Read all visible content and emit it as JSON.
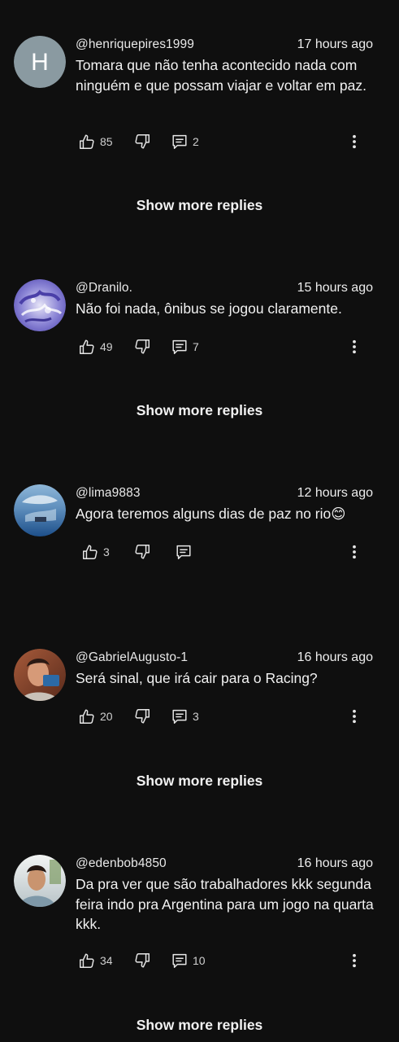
{
  "comments": [
    {
      "author": "@henriquepires1999",
      "time": "17 hours ago",
      "text": "Tomara que não tenha acontecido nada com ninguém e que possam viajar e voltar em paz.",
      "avatar_letter": "H",
      "likes": "85",
      "replies": "2",
      "show_more": "Show more replies"
    },
    {
      "author": "@Dranilo.",
      "time": "15 hours ago",
      "text": "Não foi nada, ônibus se jogou claramente.",
      "likes": "49",
      "replies": "7",
      "show_more": "Show more replies"
    },
    {
      "author": "@lima9883",
      "time": "12 hours ago",
      "text": "Agora teremos alguns dias de paz no rio😊",
      "likes": "3",
      "replies": ""
    },
    {
      "author": "@GabrielAugusto-1",
      "time": "16 hours ago",
      "text": "Será sinal, que irá cair para o Racing?",
      "likes": "20",
      "replies": "3",
      "show_more": "Show more replies"
    },
    {
      "author": "@edenbob4850",
      "time": "16 hours ago",
      "text": "Da pra ver que são trabalhadores kkk segunda feira indo pra Argentina para um jogo na quarta kkk.",
      "likes": "34",
      "replies": "10",
      "show_more": "Show more replies"
    }
  ],
  "icons": {
    "like": "thumbs-up-icon",
    "dislike": "thumbs-down-icon",
    "reply": "comment-icon",
    "more": "more-vertical-icon"
  },
  "colors": {
    "background": "#0f0f0f",
    "text": "#f1f1f1",
    "secondary": "#cfcfcf",
    "avatar_h": "#8a9aa1"
  }
}
